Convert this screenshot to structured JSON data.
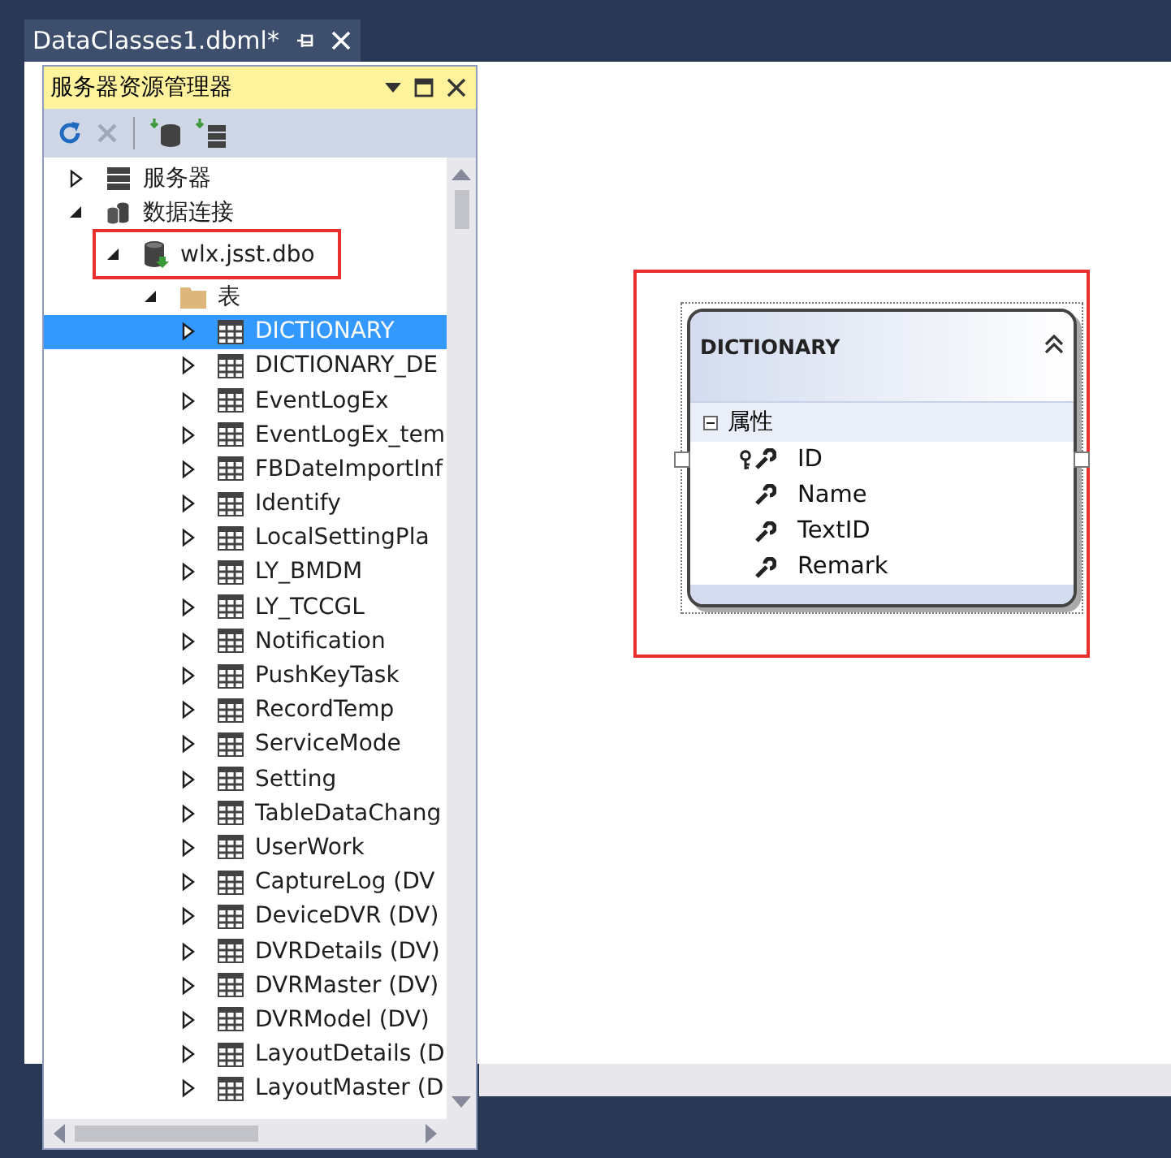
{
  "document_tab": {
    "title": "DataClasses1.dbml*"
  },
  "server_explorer": {
    "title": "服务器资源管理器",
    "toolbar": [
      {
        "kind": "refresh",
        "disabled": false
      },
      {
        "kind": "delete",
        "disabled": true
      },
      {
        "kind": "add-connection",
        "disabled": false
      },
      {
        "kind": "add-server",
        "disabled": false
      }
    ],
    "tree": [
      {
        "label": "服务器",
        "kind": "servers",
        "expanded": false,
        "selected": false,
        "highlighted": false
      },
      {
        "label": "数据连接",
        "kind": "connections",
        "expanded": true,
        "selected": false,
        "highlighted": false,
        "children": [
          {
            "label": "wlx.jsst.dbo",
            "kind": "database",
            "expanded": true,
            "selected": false,
            "highlighted": true,
            "children": [
              {
                "label": "表",
                "kind": "folder",
                "expanded": true,
                "selected": false,
                "highlighted": false,
                "children": [
                  {
                    "label": "DICTIONARY",
                    "kind": "table",
                    "expanded": false,
                    "selected": true,
                    "highlighted": false
                  },
                  {
                    "label": "DICTIONARY_DE",
                    "kind": "table",
                    "expanded": false,
                    "selected": false,
                    "highlighted": false
                  },
                  {
                    "label": "EventLogEx",
                    "kind": "table",
                    "expanded": false,
                    "selected": false,
                    "highlighted": false
                  },
                  {
                    "label": "EventLogEx_tem",
                    "kind": "table",
                    "expanded": false,
                    "selected": false,
                    "highlighted": false
                  },
                  {
                    "label": "FBDateImportInf",
                    "kind": "table",
                    "expanded": false,
                    "selected": false,
                    "highlighted": false
                  },
                  {
                    "label": "Identify",
                    "kind": "table",
                    "expanded": false,
                    "selected": false,
                    "highlighted": false
                  },
                  {
                    "label": "LocalSettingPla",
                    "kind": "table",
                    "expanded": false,
                    "selected": false,
                    "highlighted": false
                  },
                  {
                    "label": "LY_BMDM",
                    "kind": "table",
                    "expanded": false,
                    "selected": false,
                    "highlighted": false
                  },
                  {
                    "label": "LY_TCCGL",
                    "kind": "table",
                    "expanded": false,
                    "selected": false,
                    "highlighted": false
                  },
                  {
                    "label": "Notification",
                    "kind": "table",
                    "expanded": false,
                    "selected": false,
                    "highlighted": false
                  },
                  {
                    "label": "PushKeyTask",
                    "kind": "table",
                    "expanded": false,
                    "selected": false,
                    "highlighted": false
                  },
                  {
                    "label": "RecordTemp",
                    "kind": "table",
                    "expanded": false,
                    "selected": false,
                    "highlighted": false
                  },
                  {
                    "label": "ServiceMode",
                    "kind": "table",
                    "expanded": false,
                    "selected": false,
                    "highlighted": false
                  },
                  {
                    "label": "Setting",
                    "kind": "table",
                    "expanded": false,
                    "selected": false,
                    "highlighted": false
                  },
                  {
                    "label": "TableDataChang",
                    "kind": "table",
                    "expanded": false,
                    "selected": false,
                    "highlighted": false
                  },
                  {
                    "label": "UserWork",
                    "kind": "table",
                    "expanded": false,
                    "selected": false,
                    "highlighted": false
                  },
                  {
                    "label": "CaptureLog (DV",
                    "kind": "table",
                    "expanded": false,
                    "selected": false,
                    "highlighted": false
                  },
                  {
                    "label": "DeviceDVR (DV)",
                    "kind": "table",
                    "expanded": false,
                    "selected": false,
                    "highlighted": false
                  },
                  {
                    "label": "DVRDetails (DV)",
                    "kind": "table",
                    "expanded": false,
                    "selected": false,
                    "highlighted": false
                  },
                  {
                    "label": "DVRMaster (DV)",
                    "kind": "table",
                    "expanded": false,
                    "selected": false,
                    "highlighted": false
                  },
                  {
                    "label": "DVRModel (DV)",
                    "kind": "table",
                    "expanded": false,
                    "selected": false,
                    "highlighted": false
                  },
                  {
                    "label": "LayoutDetails (D",
                    "kind": "table",
                    "expanded": false,
                    "selected": false,
                    "highlighted": false
                  },
                  {
                    "label": "LayoutMaster (D",
                    "kind": "table",
                    "expanded": false,
                    "selected": false,
                    "highlighted": false
                  }
                ]
              }
            ]
          }
        ]
      }
    ]
  },
  "designer": {
    "highlighted": true,
    "entity": {
      "name": "DICTIONARY",
      "section": {
        "title": "属性",
        "expanded": true
      },
      "properties": [
        {
          "name": "ID",
          "primary_key": true
        },
        {
          "name": "Name",
          "primary_key": false
        },
        {
          "name": "TextID",
          "primary_key": false
        },
        {
          "name": "Remark",
          "primary_key": false
        }
      ]
    }
  }
}
